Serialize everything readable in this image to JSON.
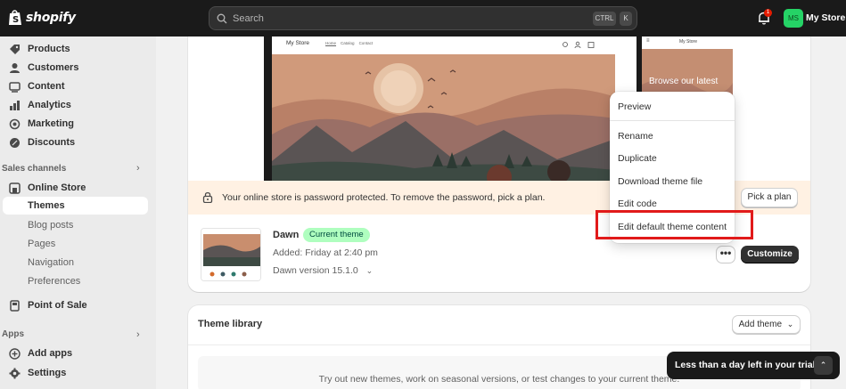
{
  "topbar": {
    "brand": "shopify",
    "search_placeholder": "Search",
    "shortcut_ctrl": "CTRL",
    "shortcut_key": "K",
    "notification_count": "1",
    "store_initials": "MS",
    "store_name": "My Store"
  },
  "sidebar": {
    "items": [
      {
        "label": "Products",
        "icon": "tag-icon"
      },
      {
        "label": "Customers",
        "icon": "person-icon"
      },
      {
        "label": "Content",
        "icon": "content-icon"
      },
      {
        "label": "Analytics",
        "icon": "chart-icon"
      },
      {
        "label": "Marketing",
        "icon": "target-icon"
      },
      {
        "label": "Discounts",
        "icon": "discount-icon"
      }
    ],
    "sales_channels_label": "Sales channels",
    "online_store_label": "Online Store",
    "sub_items": [
      "Themes",
      "Blog posts",
      "Pages",
      "Navigation",
      "Preferences"
    ],
    "point_of_sale_label": "Point of Sale",
    "apps_label": "Apps",
    "add_apps_label": "Add apps",
    "settings_label": "Settings"
  },
  "preview": {
    "desktop_store": "My Store",
    "desktop_links": [
      "Home",
      "Catalog",
      "Contact"
    ],
    "mobile_store": "My Store",
    "mobile_heading": "Browse our latest"
  },
  "banner": {
    "text": "Your online store is password protected. To remove the password, pick a plan.",
    "button": "Pick a plan"
  },
  "current_theme": {
    "name": "Dawn",
    "badge": "Current theme",
    "added": "Added: Friday at 2:40 pm",
    "version": "Dawn version 15.1.0",
    "more_label": "•••",
    "customize_label": "Customize"
  },
  "menu": {
    "items": [
      "Preview",
      "Rename",
      "Duplicate",
      "Download theme file",
      "Edit code",
      "Edit default theme content"
    ]
  },
  "library": {
    "title": "Theme library",
    "add_theme": "Add theme",
    "empty_text": "Try out new themes, work on seasonal versions, or test changes to your current theme."
  },
  "toast": {
    "text": "Less than a day left in your trial"
  },
  "colors": {
    "topbar": "#1a1a1a",
    "badge_green": "#affebf",
    "banner": "#fff1e3",
    "highlight": "#e11a1a",
    "avatar": "#25d366"
  }
}
